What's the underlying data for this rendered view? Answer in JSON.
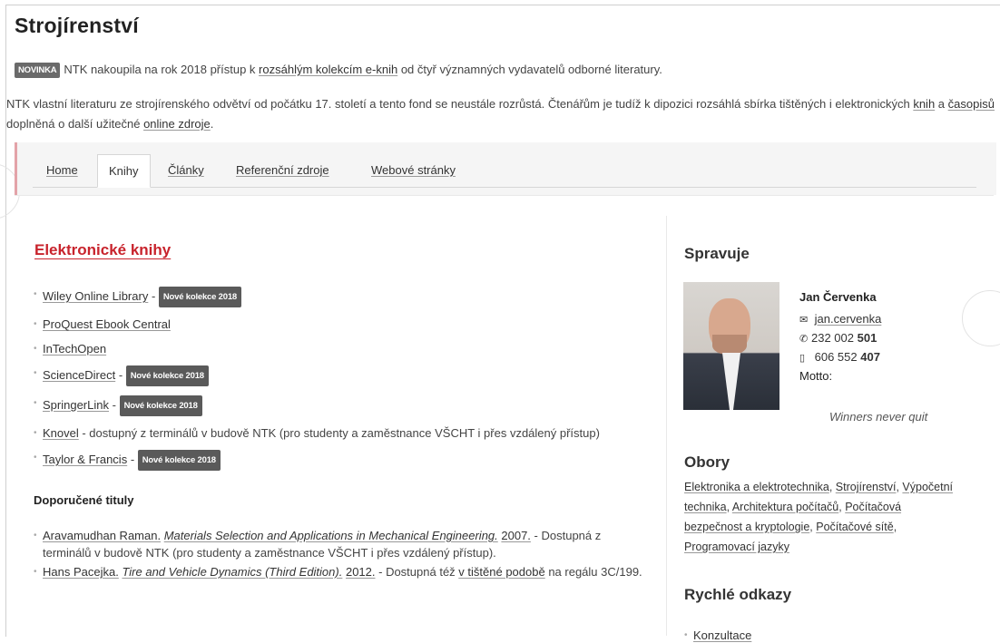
{
  "page": {
    "title": "Strojírenství"
  },
  "news": {
    "badge": "NOVINKA",
    "text_before": "NTK nakoupila na rok 2018 přístup k ",
    "link": "rozsáhlým kolekcím e-knih",
    "text_after": " od čtyř významných vydavatelů odborné literatury."
  },
  "intro": {
    "part1": "NTK vlastní literaturu ze strojírenského odvětví od počátku 17. století a tento fond se neustále rozrůstá. Čtenářům je tudíž k dipozici rozsáhlá sbírka tištěných i elektronických ",
    "link_knih": "knih",
    "part2": " a ",
    "link_casopisu": "časopisů",
    "part3": " doplněná o další užitečné ",
    "link_online": "online zdroje",
    "part4": "."
  },
  "tabs": [
    {
      "label": "Home"
    },
    {
      "label": "Knihy"
    },
    {
      "label": "Články"
    },
    {
      "label": "Referenční zdroje"
    },
    {
      "label": "Webové stránky"
    }
  ],
  "ebooks": {
    "heading": "Elektronické knihy",
    "items": [
      {
        "label": "Wiley Online Library",
        "sep": " - ",
        "tag": "Nové kolekce 2018"
      },
      {
        "label": "ProQuest Ebook Central"
      },
      {
        "label": "InTechOpen"
      },
      {
        "label": "ScienceDirect",
        "sep": " - ",
        "tag": "Nové kolekce 2018"
      },
      {
        "label": "SpringerLink",
        "sep": " - ",
        "tag": "Nové kolekce 2018"
      },
      {
        "label": "Knovel",
        "note": " - dostupný z terminálů v budově NTK (pro studenty a zaměstnance VŠCHT i přes vzdálený přístup)"
      },
      {
        "label": "Taylor & Francis",
        "sep": " - ",
        "tag": "Nové kolekce 2018"
      }
    ]
  },
  "recommended": {
    "heading": "Doporučené tituly",
    "items": [
      {
        "author": "Aravamudhan Raman.",
        "title": "Materials Selection and Applications in Mechanical Engineering.",
        "year": "2007.",
        "note": " - Dostupná z terminálů v budově NTK (pro studenty a zaměstnance VŠCHT i přes vzdálený přístup)."
      },
      {
        "author": "Hans Pacejka.",
        "title": "Tire and Vehicle Dynamics (Third Edition).",
        "year": "2012.",
        "note": " - Dostupná též ",
        "link": "v tištěné podobě",
        "note2": " na regálu 3C/199."
      }
    ]
  },
  "sidebar": {
    "spravuje_heading": "Spravuje",
    "person": {
      "name": "Jan Červenka",
      "email": "jan.cervenka",
      "phone_prefix": "232 002 ",
      "phone_ext": "501",
      "mobile_prefix": "606 552 ",
      "mobile_ext": "407",
      "motto_label": "Motto:",
      "motto": "Winners never quit"
    },
    "obory_heading": "Obory",
    "obory": [
      {
        "label": "Elektronika a elektrotechnika",
        "sep": ", "
      },
      {
        "label": "Strojírenství",
        "sep": ", "
      },
      {
        "label": "Výpočetní technika",
        "sep": ", "
      },
      {
        "label": "Architektura počítačů",
        "sep": ", "
      },
      {
        "label": "Počítačová bezpečnost a kryptologie",
        "sep": ", "
      },
      {
        "label": "Počítačové sítě",
        "sep": ", "
      },
      {
        "label": "Programovací jazyky",
        "sep": ""
      }
    ],
    "quick_heading": "Rychlé odkazy",
    "quick": [
      {
        "label": "Konzultace"
      }
    ]
  },
  "colors": {
    "accent_red": "#c8232c",
    "badge_gray": "#5a5a5a",
    "tabbar_border": "#e3a3a8"
  }
}
